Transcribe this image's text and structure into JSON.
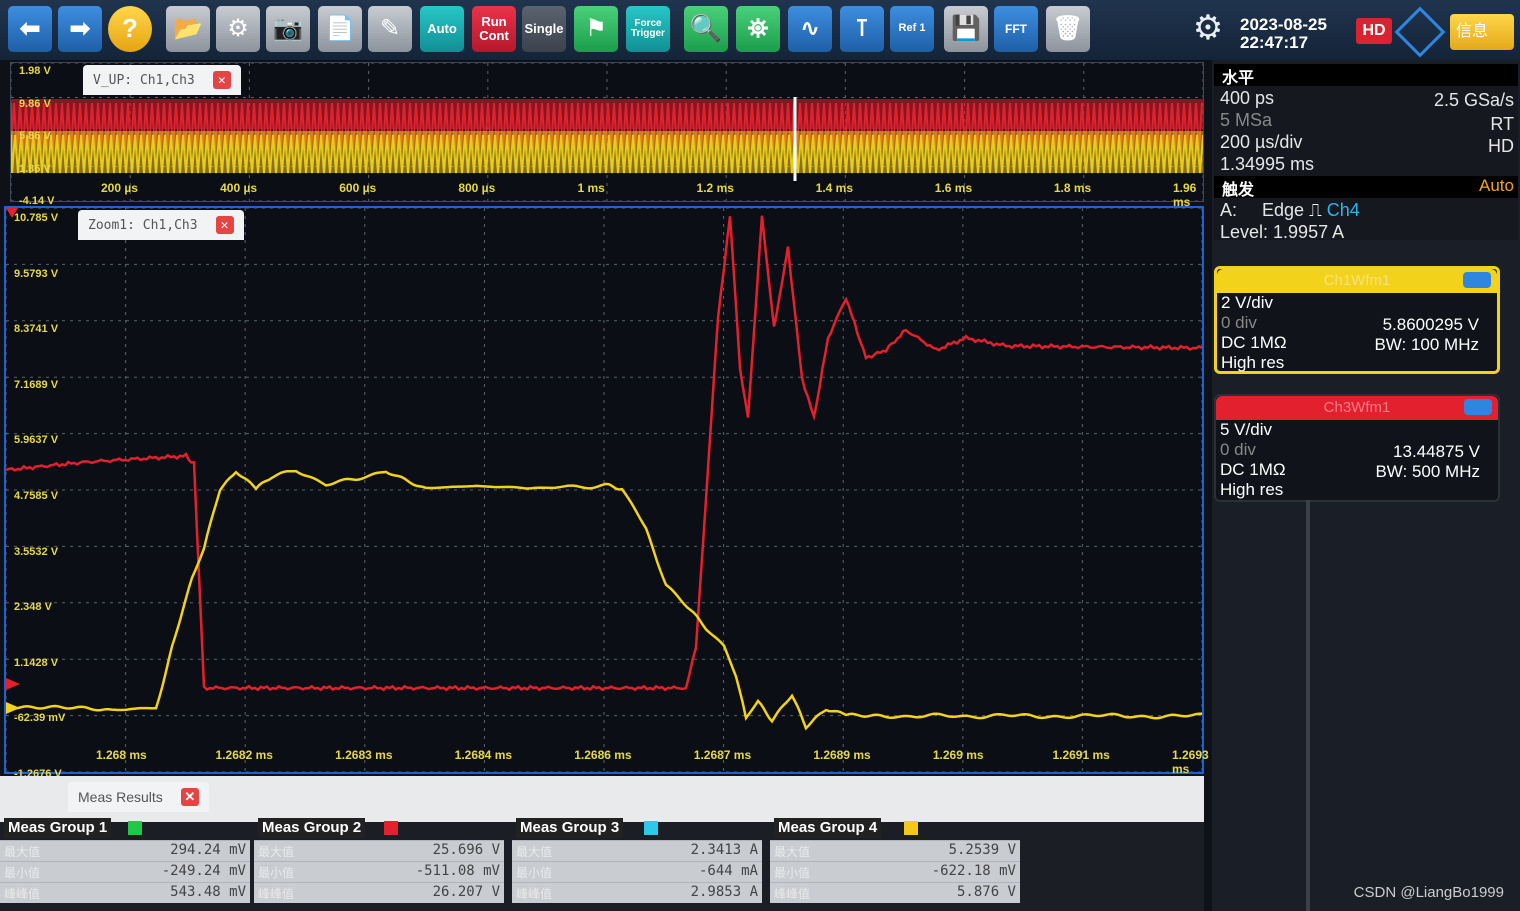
{
  "toolbar": {
    "auto_label": "Auto",
    "run_label": "Run\nCont",
    "single_label": "Single",
    "force_label": "Force\nTrigger",
    "ref_label": "Ref 1",
    "fft_label": "FFT",
    "date": "2023-08-25",
    "time": "22:47:17",
    "hd_badge": "HD",
    "info_label": "信息"
  },
  "overview": {
    "tab_title": "V_UP: Ch1,Ch3",
    "y_labels": [
      "1.98 V",
      "9.86 V",
      "5.86 V",
      "1.86 V",
      "-4.14 V"
    ],
    "x_labels": [
      "200 µs",
      "400 µs",
      "600 µs",
      "800 µs",
      "1 ms",
      "1.2 ms",
      "1.4 ms",
      "1.6 ms",
      "1.8 ms",
      "1.96 ms"
    ]
  },
  "zoom": {
    "tab_title": "Zoom1: Ch1,Ch3",
    "y_labels": [
      "10.785 V",
      "9.5793 V",
      "8.3741 V",
      "7.1689 V",
      "5.9637 V",
      "4.7585 V",
      "3.5532 V",
      "2.348 V",
      "1.1428 V",
      "-62.39 mV",
      "-1.2676 V"
    ],
    "x_labels": [
      "1.268 ms",
      "1.2682 ms",
      "1.2683 ms",
      "1.2684 ms",
      "1.2686 ms",
      "1.2687 ms",
      "1.2689 ms",
      "1.269 ms",
      "1.2691 ms",
      "1.2693 ms"
    ]
  },
  "horizontal": {
    "heading": "水平",
    "resolution": "400 ps",
    "sample_rate": "2.5 GSa/s",
    "record_len": "5 MSa",
    "mode_rt": "RT",
    "time_div": "200 µs/div",
    "mode_hd": "HD",
    "position": "1.34995 ms"
  },
  "trigger": {
    "heading": "触发",
    "mode": "Auto",
    "source_row": "A:     Edge",
    "channel": "Ch4",
    "level": "Level: 1.9957 A"
  },
  "ch1": {
    "header": "Ch1Wfm1",
    "scale": "2 V/div",
    "offset": "0 div",
    "value": "5.8600295 V",
    "coupling": "DC 1MΩ",
    "bw": "BW: 100 MHz",
    "mode": "High res",
    "color": "#f2d21b"
  },
  "ch3": {
    "header": "Ch3Wfm1",
    "scale": "5 V/div",
    "offset": "0 div",
    "value": "13.44875 V",
    "coupling": "DC 1MΩ",
    "bw": "BW: 500 MHz",
    "mode": "High res",
    "color": "#e3202e"
  },
  "meas": {
    "tab_title": "Meas Results",
    "groups": [
      {
        "title": "Meas Group 1",
        "color": "#21c94a",
        "rows": [
          {
            "label": "最大值",
            "value": "294.24 mV"
          },
          {
            "label": "最小值",
            "value": "-249.24 mV"
          },
          {
            "label": "峰峰值",
            "value": "543.48 mV"
          }
        ]
      },
      {
        "title": "Meas Group 2",
        "color": "#e3202e",
        "rows": [
          {
            "label": "最大值",
            "value": "25.696 V"
          },
          {
            "label": "最小值",
            "value": "-511.08 mV"
          },
          {
            "label": "峰峰值",
            "value": "26.207 V"
          }
        ]
      },
      {
        "title": "Meas Group 3",
        "color": "#2ec9e8",
        "rows": [
          {
            "label": "最大值",
            "value": "2.3413 A"
          },
          {
            "label": "最小值",
            "value": "-644 mA"
          },
          {
            "label": "峰峰值",
            "value": "2.9853 A"
          }
        ]
      },
      {
        "title": "Meas Group 4",
        "color": "#f2c81b",
        "rows": [
          {
            "label": "最大值",
            "value": "5.2539 V"
          },
          {
            "label": "最小值",
            "value": "-622.18 mV"
          },
          {
            "label": "峰峰值",
            "value": "5.876 V"
          }
        ]
      }
    ]
  },
  "watermark": "CSDN @LiangBo1999"
}
